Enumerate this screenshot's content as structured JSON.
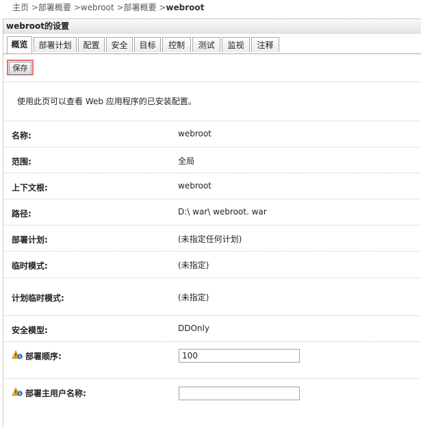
{
  "breadcrumb": {
    "home": "主页",
    "sep": " >",
    "item1": "部署概要",
    "item2": "webroot",
    "item3": "部署概要",
    "current": "webroot"
  },
  "panel": {
    "title": "webroot的设置"
  },
  "tabs": [
    {
      "label": "概览",
      "active": true
    },
    {
      "label": "部署计划"
    },
    {
      "label": "配置"
    },
    {
      "label": "安全"
    },
    {
      "label": "目标"
    },
    {
      "label": "控制"
    },
    {
      "label": "测试"
    },
    {
      "label": "监视"
    },
    {
      "label": "注释"
    }
  ],
  "toolbar": {
    "save_label": "保存"
  },
  "intro": "使用此页可以查看 Web 应用程序的已安装配置。",
  "fields": [
    {
      "label": "名称:",
      "value": "webroot"
    },
    {
      "label": "范围:",
      "value": "全局"
    },
    {
      "label": "上下文根:",
      "value": "webroot"
    },
    {
      "label": "路径:",
      "value": "D:\\ war\\ webroot. war"
    },
    {
      "label": "部署计划:",
      "value": "(未指定任何计划)"
    },
    {
      "label": "临时模式:",
      "value": "(未指定)"
    },
    {
      "label": "计划临时模式:",
      "value": "(未指定)"
    },
    {
      "label": "安全模型:",
      "value": "DDOnly"
    }
  ],
  "deploy_order": {
    "label": "部署顺序:",
    "value": "100",
    "icon": "warning-info-icon"
  },
  "principal": {
    "label": "部署主用户名称:",
    "value": "",
    "icon": "warning-info-icon"
  },
  "colors": {
    "warning_icon": "#f0c020",
    "save_border": "#e07070"
  }
}
